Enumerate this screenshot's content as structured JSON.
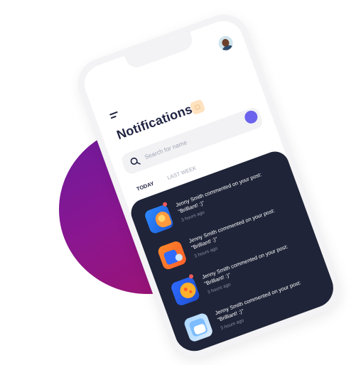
{
  "header": {
    "title": "Notifications",
    "badge_icon": "bell-icon"
  },
  "search": {
    "placeholder": "Search for name",
    "icon": "search-icon"
  },
  "tabs": [
    {
      "label": "TODAY",
      "active": true
    },
    {
      "label": "LAST WEEK",
      "active": false
    }
  ],
  "notifications": [
    {
      "message": "Jenny Smith commented on your post: \"Brilliant! :)\"",
      "time": "3 hours ago",
      "unread": true
    },
    {
      "message": "Jenny Smith commented on your post: \"Brilliant! :)\"",
      "time": "3 hours ago",
      "unread": false
    },
    {
      "message": "Jenny Smith commented on your post: \"Brilliant! :)\"",
      "time": "3 hours ago",
      "unread": true
    },
    {
      "message": "Jenny Smith commented on your post: \"Brilliant! :)\"",
      "time": "3 hours ago",
      "unread": false
    }
  ],
  "colors": {
    "accent": "#6b63ee",
    "dark_panel": "#1f2438",
    "title": "#1f2340",
    "unread_dot": "#f05a5a",
    "blob_start": "#6b1b9e",
    "blob_end": "#a0126a"
  }
}
